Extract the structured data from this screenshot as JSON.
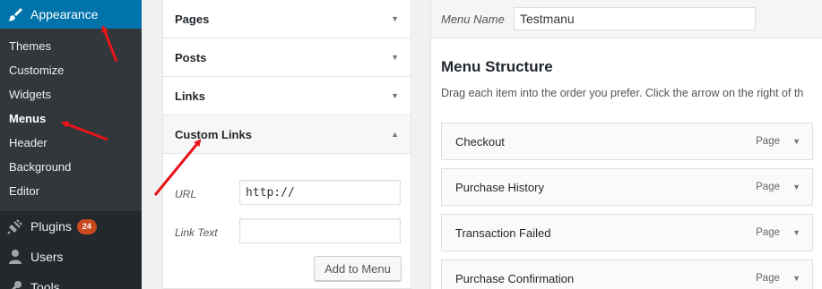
{
  "sidebar": {
    "appearance": {
      "label": "Appearance",
      "icon": "paintbrush-icon"
    },
    "submenu": [
      "Themes",
      "Customize",
      "Widgets",
      "Menus",
      "Header",
      "Background",
      "Editor"
    ],
    "current_submenu": "Menus",
    "plugins": {
      "label": "Plugins",
      "badge": "24",
      "icon": "plugin-icon"
    },
    "users": {
      "label": "Users",
      "icon": "users-icon"
    },
    "tools": {
      "label": "Tools",
      "icon": "wrench-icon"
    }
  },
  "accordion": {
    "sections": [
      "Pages",
      "Posts",
      "Links",
      "Custom Links"
    ],
    "custom_links": {
      "url_label": "URL",
      "url_value": "http://",
      "link_text_label": "Link Text",
      "link_text_value": "",
      "add_button": "Add to Menu"
    }
  },
  "manage": {
    "menu_name_label": "Menu Name",
    "menu_name_value": "Testmanu",
    "structure_title": "Menu Structure",
    "structure_desc": "Drag each item into the order you prefer. Click the arrow on the right of th",
    "items": [
      {
        "title": "Checkout",
        "type": "Page"
      },
      {
        "title": "Purchase History",
        "type": "Page"
      },
      {
        "title": "Transaction Failed",
        "type": "Page"
      },
      {
        "title": "Purchase Confirmation",
        "type": "Page"
      }
    ]
  },
  "colors": {
    "sidebar": "#23282d",
    "submenu": "#32373c",
    "active": "#0073aa",
    "badge": "#ca4a1f",
    "annotation_arrow": "#e8141a"
  }
}
